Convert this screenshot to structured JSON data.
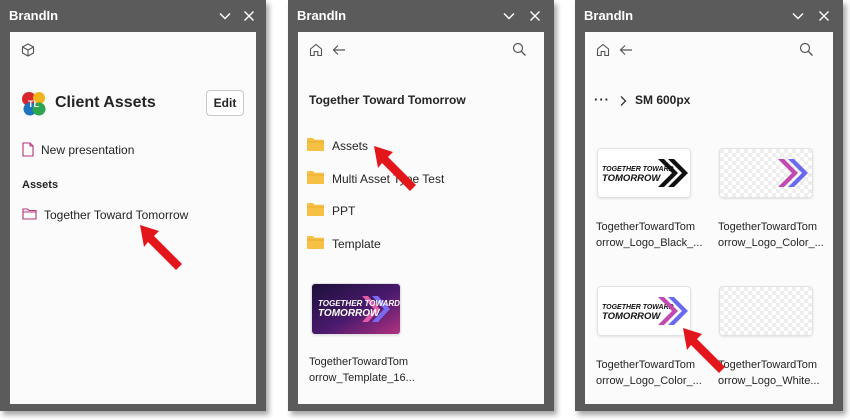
{
  "panels": [
    {
      "title": "BrandIn",
      "header_title": "Client Assets",
      "edit_label": "Edit",
      "new_presentation_label": "New presentation",
      "section_label": "Assets",
      "folder_label": "Together Toward Tomorrow"
    },
    {
      "title": "BrandIn",
      "heading": "Together Toward Tomorrow",
      "folders": [
        "Assets",
        "Multi Asset Type Test",
        "PPT",
        "Template"
      ],
      "file_name_line1": "TogetherTowardTom",
      "file_name_line2": "orrow_Template_16..."
    },
    {
      "title": "BrandIn",
      "breadcrumb_ellipsis": "···",
      "breadcrumb_current": "SM 600px",
      "files": [
        {
          "line1": "TogetherTowardTom",
          "line2": "orrow_Logo_Black_..."
        },
        {
          "line1": "TogetherTowardTom",
          "line2": "orrow_Logo_Color_..."
        },
        {
          "line1": "TogetherTowardTom",
          "line2": "orrow_Logo_Color_..."
        },
        {
          "line1": "TogetherTowardTom",
          "line2": "orrow_Logo_White..."
        }
      ]
    }
  ],
  "logo_text_line1": "TOGETHER TOWARD",
  "logo_text_line2": "TOMORROW",
  "colors": {
    "chrome": "#5b5b5b",
    "accent": "#b4357a",
    "folder": "#f5c044",
    "arrow": "#e3161b"
  }
}
